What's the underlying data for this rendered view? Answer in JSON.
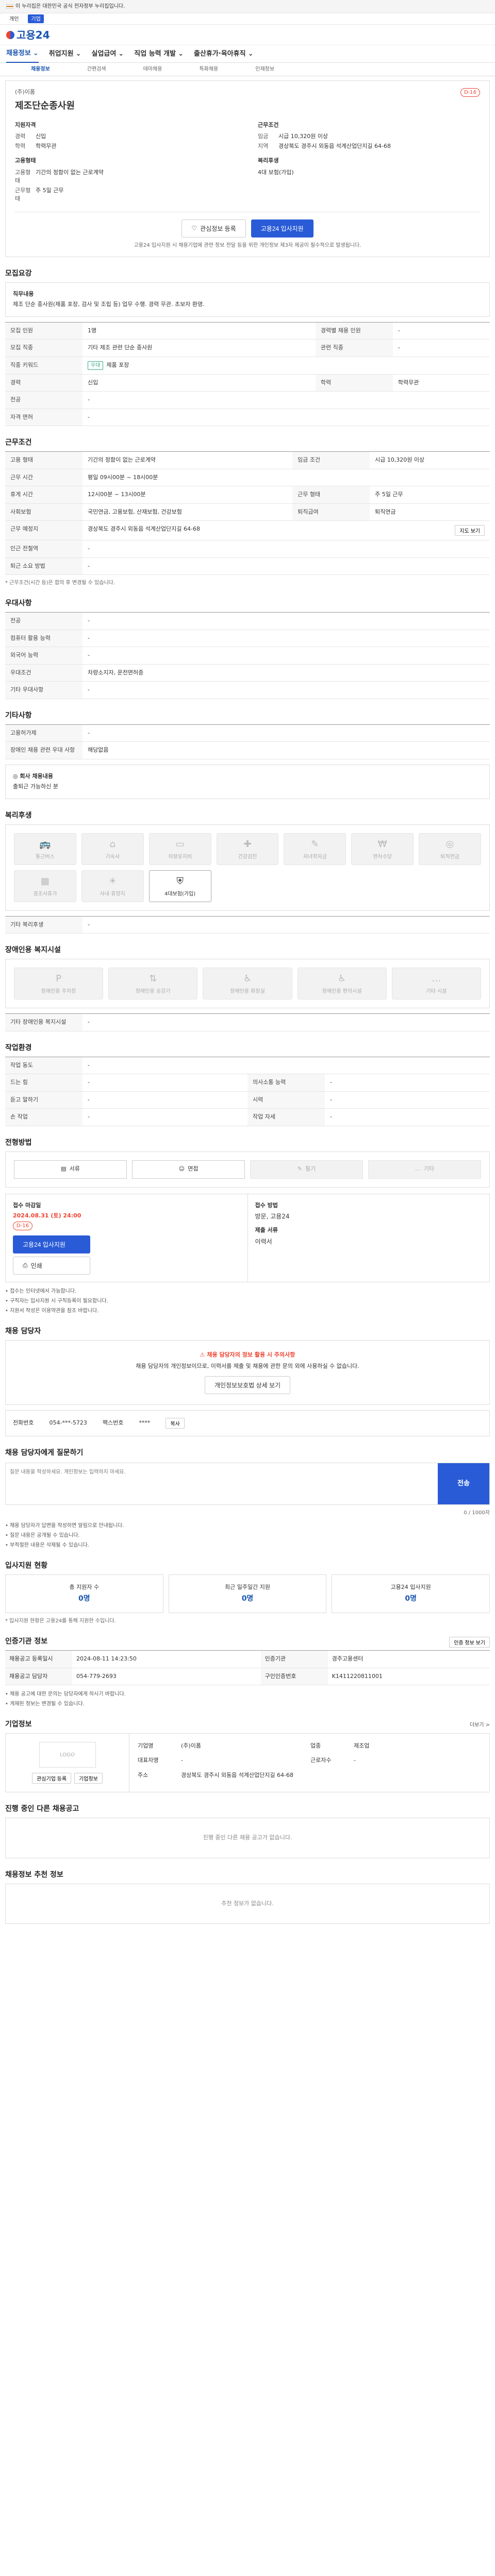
{
  "gov_banner": {
    "text": "이 누리집은 대한민국 공식 전자정부 누리집입니다."
  },
  "top_tabs": [
    "개인",
    "기업"
  ],
  "logo": {
    "text": "고용24"
  },
  "nav": [
    {
      "label": "채용정보"
    },
    {
      "label": "취업지원"
    },
    {
      "label": "실업급여"
    },
    {
      "label": "직업 능력 개발"
    },
    {
      "label": "출산휴가·육아휴직"
    }
  ],
  "subnav": [
    "채용정보",
    "간편검색",
    "테마채용",
    "특화채용",
    "인재정보"
  ],
  "job": {
    "company": "(주)이폼",
    "title": "제조단순종사원",
    "dday": "D-16",
    "left_title": "지원자격",
    "left": [
      {
        "k": "경력",
        "v": "신입"
      },
      {
        "k": "학력",
        "v": "학력무관"
      }
    ],
    "left_title2": "고용형태",
    "left2": [
      {
        "k": "고용형태",
        "v": "기간의 정함이 없는 근로계약"
      },
      {
        "k": "근무형태",
        "v": "주 5일 근무"
      }
    ],
    "right_title": "근무조건",
    "right": [
      {
        "k": "임금",
        "v": "시급 10,320원 이상"
      },
      {
        "k": "지역",
        "v": "경상북도 경주시 외동읍 석계산업단지길 64-68"
      }
    ],
    "right_title2": "복리후생",
    "right2": "4대 보험(가입)",
    "btn_interest": "관심정보 등록",
    "btn_apply": "고용24 입사지원",
    "notice": "고용24 입사지원 시 채용기업에 관련 정보 전달 등을 위한 개인정보 제3자 제공이 필수적으로 발생됩니다."
  },
  "summary": {
    "title": "모집요강",
    "box_title": "직무내용",
    "box_text": "제조 단순 종사원(제품 포장, 검사 및 조립 등) 업무 수행. 경력 무관. 초보자 환영.",
    "rows": [
      [
        "모집 인원",
        "1명",
        "경력별 채용 인원",
        "-"
      ],
      [
        "모집 직종",
        "기타 제조 관련 단순 종사원",
        "관련 직종",
        "-"
      ],
      [
        "직종 키워드",
        "제품 포장",
        "",
        ""
      ],
      [
        "경력",
        "신입",
        "학력",
        "학력무관"
      ],
      [
        "전공",
        "-",
        "",
        ""
      ],
      [
        "자격 면허",
        "-",
        "",
        ""
      ]
    ],
    "keyword_tag": "우대"
  },
  "work": {
    "title": "근무조건",
    "rows": [
      [
        "고용 형태",
        "기간의 정함이 없는 근로계약",
        "임금 조건",
        "시급 10,320원 이상"
      ],
      [
        "근무 시간",
        "평일 09시00분 ~ 18시00분",
        "",
        ""
      ],
      [
        "휴게 시간",
        "12시00분 ~ 13시00분",
        "근무 형태",
        "주 5일 근무"
      ],
      [
        "사회보험",
        "국민연금, 고용보험, 산재보험, 건강보험",
        "퇴직급여",
        "퇴직연금"
      ],
      [
        "근무 예정지",
        "경상북도 경주시 외동읍 석계산업단지길 64-68",
        "",
        ""
      ],
      [
        "인근 전철역",
        "-",
        "",
        ""
      ],
      [
        "퇴근 소요 방법",
        "-",
        "",
        ""
      ]
    ],
    "map_btn": "지도 보기",
    "note": "* 근무조건(시간 등)은 합의 후 변경될 수 있습니다."
  },
  "pref": {
    "title": "우대사항",
    "rows": [
      [
        "전공",
        "-"
      ],
      [
        "컴퓨터 활용 능력",
        "-"
      ],
      [
        "외국어 능력",
        "-"
      ],
      [
        "우대조건",
        "차량소지자, 운전면허증"
      ],
      [
        "기타 우대사항",
        "-"
      ]
    ]
  },
  "etc": {
    "title": "기타사항",
    "rows": [
      [
        "고용허가제",
        "-"
      ],
      [
        "장애인 채용 관련 우대 사항",
        "해당없음"
      ]
    ],
    "box_title": "◎ 회사 채용내용",
    "box_text": "출퇴근 가능하신 분"
  },
  "welfare": {
    "title": "복리후생",
    "items": [
      "통근버스",
      "기숙사",
      "차량유지비",
      "건강검진",
      "자녀학자금",
      "연차수당",
      "퇴직연금",
      "경조사휴가",
      "사내 휴양지",
      "4대보험"
    ],
    "active": "4대보험(가입)",
    "other_label": "기타 복리후생",
    "other_value": "-"
  },
  "disability": {
    "title": "장애인용 복지시설",
    "items": [
      "장애인용 주차장",
      "장애인용 승강기",
      "장애인용 화장실",
      "장애인용 편의시설",
      "기타 시설"
    ],
    "other_label": "기타 장애인용 복지시설",
    "other_value": "-"
  },
  "env": {
    "title": "작업환경",
    "rows": [
      [
        "작업 동도",
        "-",
        "",
        ""
      ],
      [
        "드는 힘",
        "-",
        "의사소통 능력",
        "-"
      ],
      [
        "듣고 말하기",
        "-",
        "시력",
        "-"
      ],
      [
        "손 작업",
        "-",
        "작업 자세",
        "-"
      ]
    ]
  },
  "method": {
    "title": "전형방법",
    "items": [
      {
        "label": "서류",
        "on": true
      },
      {
        "label": "면접",
        "on": true
      },
      {
        "label": "필기",
        "on": false
      },
      {
        "label": "기타",
        "on": false
      }
    ]
  },
  "period": {
    "title": "접수 마감일",
    "date": "2024.08.31 (토) 24:00",
    "dday": "D-16",
    "apply_btn": "고용24 입사지원",
    "print_btn": "인쇄",
    "method_title": "접수 방법",
    "method_text": "방문, 고용24",
    "doc_title": "제출 서류",
    "doc_text": "이력서"
  },
  "period_notes": [
    "접수는 인터넷에서 가능합니다.",
    "구직자는 입사지원 시 구직등록이 필요합니다.",
    "지원서 작성은 이용약관을 참조 바랍니다."
  ],
  "contact": {
    "title": "채용 담당자",
    "warn_title": "채용 담당자의 정보 활용 시 주의사항",
    "warn_text": "채용 담당자의 개인정보이므로, 이력서를 제출 및 채용에 관한 문의 외에 사용하실 수 없습니다.",
    "detail_btn": "개인정보보호법 상세 보기",
    "phone_label": "전화번호",
    "phone": "054-***-5723",
    "fax_label": "팩스번호",
    "fax": "****",
    "copy_btn": "복사"
  },
  "qa": {
    "title": "채용 담당자에게 질문하기",
    "placeholder": "질문 내용을 작성하세요. 개인정보는 입력하지 마세요.",
    "send": "전송",
    "count": "0 / 1000자",
    "notes": [
      "채용 담당자가 답변을 작성하면 알림으로 안내됩니다.",
      "질문 내용은 공개될 수 있습니다.",
      "부적절한 내용은 삭제될 수 있습니다."
    ]
  },
  "stats": {
    "title": "입사지원 현황",
    "items": [
      {
        "label": "총 지원자 수",
        "value": "0명"
      },
      {
        "label": "최근 일주일간 지원",
        "value": "0명"
      },
      {
        "label": "고용24 입사지원",
        "value": "0명"
      }
    ],
    "note": "* 입사지원 현황은 고용24를 통해 지원한 수입니다."
  },
  "reg": {
    "title": "인증기관 정보",
    "btn": "인증 정보 보기",
    "rows": [
      [
        "채용공고 등록일시",
        "2024-08-11 14:23:50",
        "인증기관",
        "경주고용센터"
      ],
      [
        "채용공고 담당자",
        "054-779-2693",
        "구인인증번호",
        "K1411220811001"
      ]
    ],
    "notes": [
      "채용 공고에 대한 문의는 담당자에게 하시기 바랍니다.",
      "게재된 정보는 변경될 수 있습니다."
    ]
  },
  "corp": {
    "title": "기업정보",
    "more": "더보기 >",
    "logo_placeholder": "LOGO",
    "btn1": "관심기업 등록",
    "btn2": "기업정보",
    "rows": [
      [
        "기업명",
        "(주)이폼",
        "업종",
        "제조업"
      ],
      [
        "대표자명",
        "-",
        "근로자수",
        "-"
      ],
      [
        "주소",
        "경상북도 경주시 외동읍 석계산업단지길 64-68",
        "",
        ""
      ]
    ]
  },
  "other_jobs": {
    "title": "진행 중인 다른 채용공고",
    "empty": "진행 중인 다른 채용 공고가 없습니다."
  },
  "recommend": {
    "title": "채용정보 추천 정보",
    "empty": "추천 정보가 없습니다."
  }
}
